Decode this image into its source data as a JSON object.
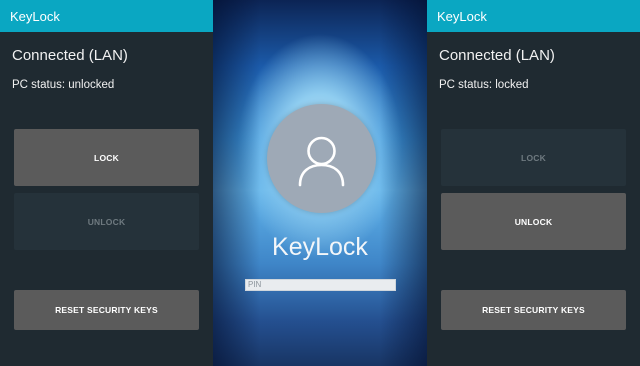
{
  "left_phone": {
    "app_title": "KeyLock",
    "connection": "Connected (LAN)",
    "pc_status": "PC status: unlocked",
    "lock_button": "LOCK",
    "unlock_button": "UNLOCK",
    "reset_button": "RESET SECURITY KEYS"
  },
  "lock_screen": {
    "user_name": "KeyLock",
    "pin_placeholder": "PIN",
    "avatar_icon": "user-icon"
  },
  "right_phone": {
    "app_title": "KeyLock",
    "connection": "Connected (LAN)",
    "pc_status": "PC status: locked",
    "lock_button": "LOCK",
    "unlock_button": "UNLOCK",
    "reset_button": "RESET SECURITY KEYS"
  },
  "colors": {
    "accent": "#0aa7c2",
    "app_background": "#1f2a31",
    "button_enabled": "#5b5b5b",
    "button_disabled": "#25323a"
  }
}
